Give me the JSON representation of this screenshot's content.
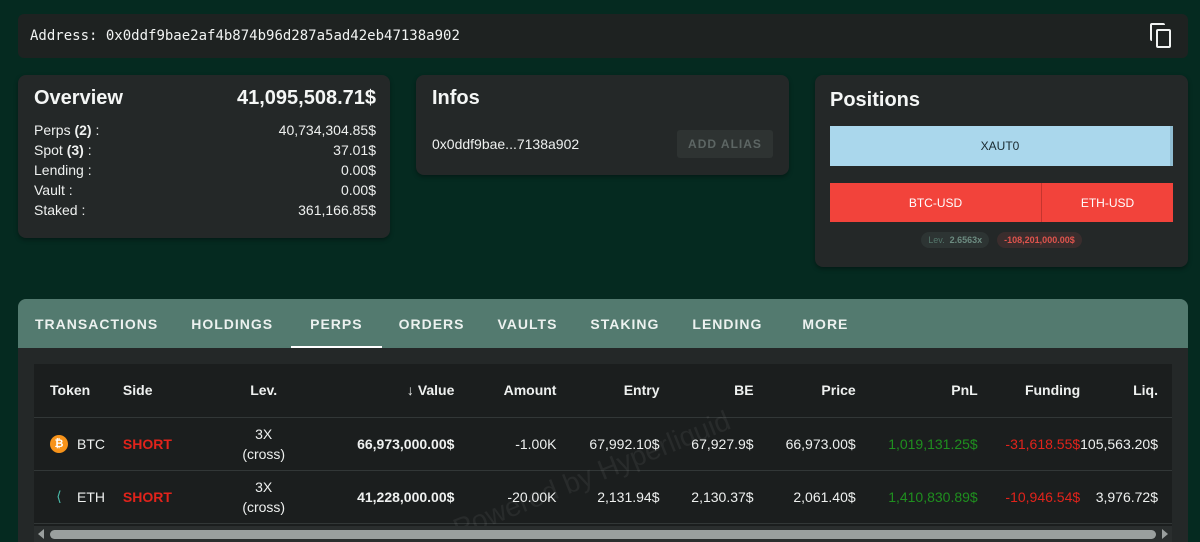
{
  "address_bar": {
    "label": "Address:",
    "value": "0x0ddf9bae2af4b874b96d287a5ad42eb47138a902"
  },
  "overview": {
    "title": "Overview",
    "total": "41,095,508.71$",
    "rows": [
      {
        "label": "Perps",
        "count": "(2)",
        "value": "40,734,304.85$"
      },
      {
        "label": "Spot",
        "count": "(3)",
        "value": "37.01$"
      },
      {
        "label": "Lending",
        "count": "",
        "value": "0.00$"
      },
      {
        "label": "Vault",
        "count": "",
        "value": "0.00$"
      },
      {
        "label": "Staked",
        "count": "",
        "value": "361,166.85$"
      }
    ]
  },
  "infos": {
    "title": "Infos",
    "short_address": "0x0ddf9bae...7138a902",
    "alias_button": "ADD ALIAS"
  },
  "positions": {
    "title": "Positions",
    "spot": "XAUT0",
    "perps": [
      "BTC-USD",
      "ETH-USD"
    ],
    "lev_label": "Lev.",
    "lev_value": "2.6563x",
    "pnl": "-108,201,000.00$"
  },
  "tabs": [
    "TRANSACTIONS",
    "HOLDINGS",
    "PERPS",
    "ORDERS",
    "VAULTS",
    "STAKING",
    "LENDING",
    "MORE"
  ],
  "active_tab": "PERPS",
  "table": {
    "headers": [
      "Token",
      "Side",
      "Lev.",
      "Value",
      "Amount",
      "Entry",
      "BE",
      "Price",
      "PnL",
      "Funding",
      "Liq."
    ],
    "sort_arrow": "↓",
    "rows": [
      {
        "token": "BTC",
        "icon": "bitcoin-icon",
        "side": "SHORT",
        "lev": "3X",
        "lev_mode": "(cross)",
        "value": "66,973,000.00$",
        "amount": "-1.00K",
        "entry": "67,992.10$",
        "be": "67,927.9$",
        "price": "66,973.00$",
        "pnl": "1,019,131.25$",
        "funding": "-31,618.55$",
        "liq": "105,563.20$"
      },
      {
        "token": "ETH",
        "icon": "ethereum-icon",
        "side": "SHORT",
        "lev": "3X",
        "lev_mode": "(cross)",
        "value": "41,228,000.00$",
        "amount": "-20.00K",
        "entry": "2,131.94$",
        "be": "2,130.37$",
        "price": "2,061.40$",
        "pnl": "1,410,830.89$",
        "funding": "-10,946.54$",
        "liq": "3,976.72$"
      }
    ]
  },
  "watermark": "Powered by Hyperliquid",
  "colors": {
    "background": "#052a20",
    "card": "#242828",
    "tab_bar": "#537a6f",
    "short": "#e1231b",
    "positive": "#1f8f1f",
    "spot_chip": "#aad7ec",
    "perp_chip": "#f2433b"
  }
}
